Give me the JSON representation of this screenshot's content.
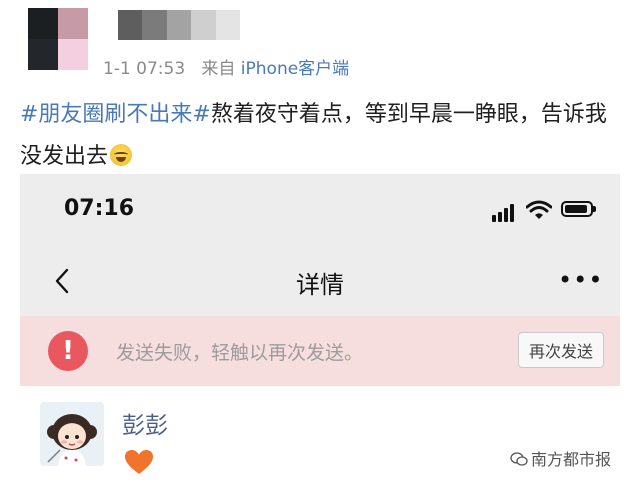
{
  "post": {
    "timestamp": "1-1 07:53",
    "source_prefix": "来自",
    "source_client": "iPhone客户端",
    "hashtag_1": "#朋友圈刷不出来#",
    "text_1": "熬着夜守着点，等到早晨一睁眼，告诉我没发出去",
    "emoji": "laughing-tears-icon"
  },
  "phone": {
    "status_time": "07:16",
    "nav": {
      "back_icon": "chevron-left-icon",
      "title": "详情",
      "more_label": "•••"
    },
    "error_banner": {
      "icon_label": "!",
      "message": "发送失败，轻触以再次发送。",
      "resend_label": "再次发送",
      "color": "#e8585e"
    },
    "moment": {
      "user_name": "彭彭",
      "like_icon": "heart-icon"
    }
  },
  "watermark": {
    "text": "南方都市报"
  }
}
